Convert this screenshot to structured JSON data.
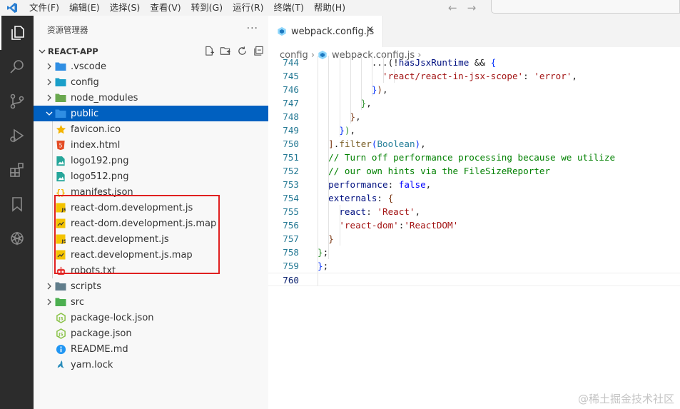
{
  "menubar": {
    "items": [
      "文件(F)",
      "编辑(E)",
      "选择(S)",
      "查看(V)",
      "转到(G)",
      "运行(R)",
      "终端(T)",
      "帮助(H)"
    ],
    "back_arrow": "←",
    "forward_arrow": "→"
  },
  "activity_bar": {
    "icons": [
      "explorer-icon",
      "search-icon",
      "source-control-icon",
      "run-debug-icon",
      "extensions-icon",
      "bookmark-icon",
      "openai-icon"
    ]
  },
  "sidebar": {
    "title": "资源管理器",
    "more": "···",
    "project_name": "REACT-APP",
    "tree": [
      {
        "label": ".vscode",
        "type": "folder",
        "expanded": false,
        "icon": "vscode-folder-icon",
        "color": "#2f8ee3"
      },
      {
        "label": "config",
        "type": "folder",
        "expanded": false,
        "icon": "config-folder-icon",
        "color": "#1a9fc9"
      },
      {
        "label": "node_modules",
        "type": "folder",
        "expanded": false,
        "icon": "node-folder-icon",
        "color": "#6aa84f"
      },
      {
        "label": "public",
        "type": "folder",
        "expanded": true,
        "selected": true,
        "icon": "public-folder-icon",
        "color": "#2f8ee3"
      },
      {
        "label": "favicon.ico",
        "type": "file",
        "icon": "star-icon",
        "color": "#f4b400"
      },
      {
        "label": "index.html",
        "type": "file",
        "icon": "html-icon",
        "color": "#e44d26"
      },
      {
        "label": "logo192.png",
        "type": "file",
        "icon": "image-icon",
        "color": "#26a69a"
      },
      {
        "label": "logo512.png",
        "type": "file",
        "icon": "image-icon",
        "color": "#26a69a"
      },
      {
        "label": "manifest.json",
        "type": "file",
        "icon": "json-icon",
        "color": "#f4b400"
      },
      {
        "label": "react-dom.development.js",
        "type": "file",
        "icon": "js-icon",
        "color": "#f4c300"
      },
      {
        "label": "react-dom.development.js.map",
        "type": "file",
        "icon": "js-map-icon",
        "color": "#f4c300"
      },
      {
        "label": "react.development.js",
        "type": "file",
        "icon": "js-icon",
        "color": "#f4c300"
      },
      {
        "label": "react.development.js.map",
        "type": "file",
        "icon": "js-map-icon",
        "color": "#f4c300"
      },
      {
        "label": "robots.txt",
        "type": "file",
        "icon": "robot-icon",
        "color": "#e53935"
      },
      {
        "label": "scripts",
        "type": "folder",
        "expanded": false,
        "icon": "scripts-folder-icon",
        "color": "#607d8b"
      },
      {
        "label": "src",
        "type": "folder",
        "expanded": false,
        "icon": "src-folder-icon",
        "color": "#4caf50"
      },
      {
        "label": "package-lock.json",
        "type": "file",
        "icon": "nodejs-icon",
        "color": "#8bc34a"
      },
      {
        "label": "package.json",
        "type": "file",
        "icon": "nodejs-icon",
        "color": "#8bc34a"
      },
      {
        "label": "README.md",
        "type": "file",
        "icon": "info-icon",
        "color": "#2196f3"
      },
      {
        "label": "yarn.lock",
        "type": "file",
        "icon": "yarn-icon",
        "color": "#2c8ebb"
      }
    ]
  },
  "editor": {
    "tab_label": "webpack.config.js",
    "tab_close": "×",
    "breadcrumb": [
      "config",
      "webpack.config.js"
    ],
    "breadcrumb_sep": "›",
    "lines": [
      {
        "num": "744",
        "tokens": [
          [
            "pn",
            "          ...("
          ],
          [
            "pn",
            "!"
          ],
          [
            "var",
            "hasJsxRuntime"
          ],
          [
            "pn",
            " && "
          ],
          [
            "b1",
            "{"
          ]
        ]
      },
      {
        "num": "745",
        "tokens": [
          [
            "pn",
            "            "
          ],
          [
            "str",
            "'react/react-in-jsx-scope'"
          ],
          [
            "pn",
            ": "
          ],
          [
            "str",
            "'error'"
          ],
          [
            "pn",
            ","
          ]
        ]
      },
      {
        "num": "746",
        "tokens": [
          [
            "pn",
            "          "
          ],
          [
            "b1",
            "}"
          ],
          [
            "b3",
            ")"
          ],
          [
            "pn",
            ","
          ]
        ]
      },
      {
        "num": "747",
        "tokens": [
          [
            "pn",
            "        "
          ],
          [
            "b2",
            "}"
          ],
          [
            "pn",
            ","
          ]
        ]
      },
      {
        "num": "748",
        "tokens": [
          [
            "pn",
            "      "
          ],
          [
            "b3",
            "}"
          ],
          [
            "pn",
            ","
          ]
        ]
      },
      {
        "num": "749",
        "tokens": [
          [
            "pn",
            "    "
          ],
          [
            "b1",
            "}"
          ],
          [
            "b2",
            ")"
          ],
          [
            "pn",
            ","
          ]
        ]
      },
      {
        "num": "750",
        "tokens": [
          [
            "pn",
            "  "
          ],
          [
            "b3",
            "]"
          ],
          [
            "pn",
            "."
          ],
          [
            "fn",
            "filter"
          ],
          [
            "b1",
            "("
          ],
          [
            "type",
            "Boolean"
          ],
          [
            "b1",
            ")"
          ],
          [
            "pn",
            ","
          ]
        ]
      },
      {
        "num": "751",
        "tokens": [
          [
            "pn",
            "  "
          ],
          [
            "cmt",
            "// Turn off performance processing because we utilize"
          ]
        ]
      },
      {
        "num": "752",
        "tokens": [
          [
            "pn",
            "  "
          ],
          [
            "cmt",
            "// our own hints via the FileSizeReporter"
          ]
        ]
      },
      {
        "num": "753",
        "tokens": [
          [
            "pn",
            "  "
          ],
          [
            "var",
            "performance"
          ],
          [
            "pn",
            ": "
          ],
          [
            "kw",
            "false"
          ],
          [
            "pn",
            ","
          ]
        ]
      },
      {
        "num": "754",
        "tokens": [
          [
            "pn",
            "  "
          ],
          [
            "var",
            "externals"
          ],
          [
            "pn",
            ": "
          ],
          [
            "b3",
            "{"
          ]
        ]
      },
      {
        "num": "755",
        "tokens": [
          [
            "pn",
            "    "
          ],
          [
            "var",
            "react"
          ],
          [
            "pn",
            ": "
          ],
          [
            "str",
            "'React'"
          ],
          [
            "pn",
            ","
          ]
        ]
      },
      {
        "num": "756",
        "tokens": [
          [
            "pn",
            "    "
          ],
          [
            "str",
            "'react-dom'"
          ],
          [
            "pn",
            ":"
          ],
          [
            "str",
            "'ReactDOM'"
          ]
        ]
      },
      {
        "num": "757",
        "tokens": [
          [
            "pn",
            "  "
          ],
          [
            "b3",
            "}"
          ]
        ]
      },
      {
        "num": "758",
        "tokens": [
          [
            "b2",
            "}"
          ],
          [
            "pn",
            ";"
          ]
        ]
      },
      {
        "num": "759",
        "tokens": [
          [
            "b1",
            "}"
          ],
          [
            "pn",
            ";"
          ]
        ]
      },
      {
        "num": "760",
        "tokens": [],
        "current": true
      }
    ]
  },
  "watermark": "@稀土掘金技术社区"
}
